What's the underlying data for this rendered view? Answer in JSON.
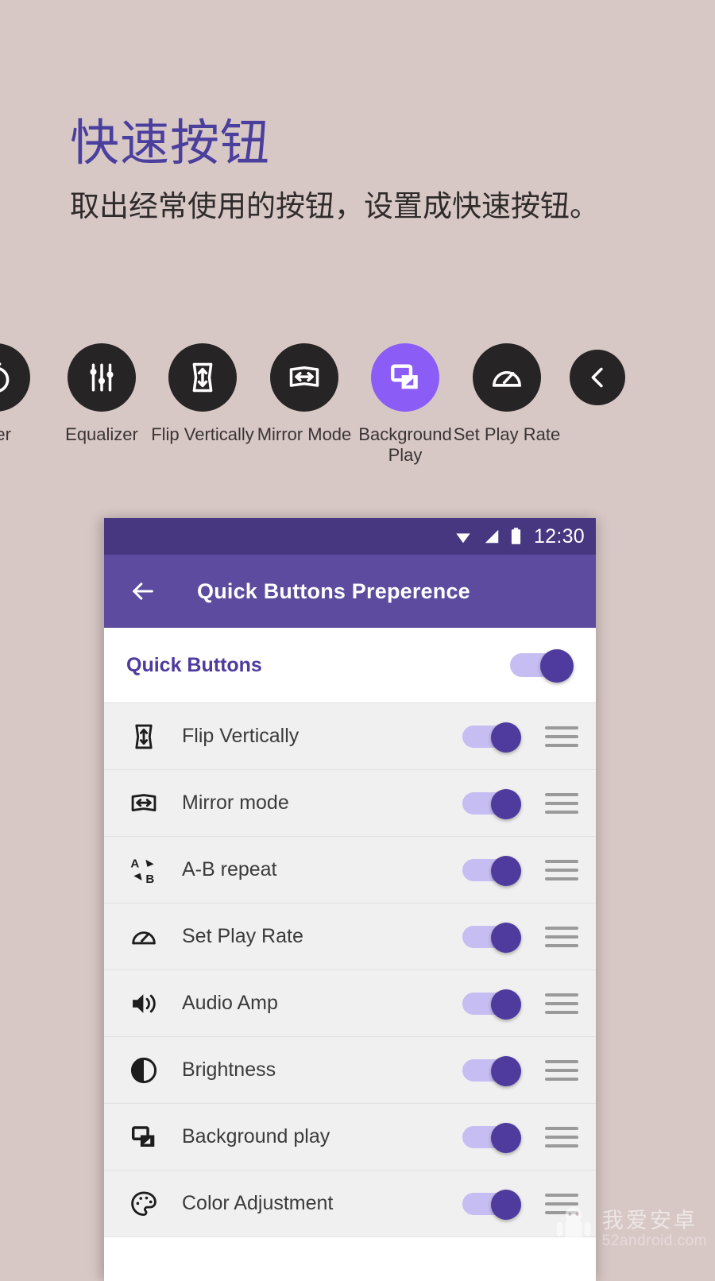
{
  "promo": {
    "title": "快速按钮",
    "subtitle": "取出经常使用的按钮，设置成快速按钮。",
    "title_color": "#4b3f9e",
    "background_color": "#d7c8c6"
  },
  "carousel": {
    "items": [
      {
        "label": "mer",
        "icon": "timer-icon",
        "active": false,
        "partial": true
      },
      {
        "label": "Equalizer",
        "icon": "equalizer-icon",
        "active": false
      },
      {
        "label": "Flip Vertically",
        "icon": "flip-vertically-icon",
        "active": false
      },
      {
        "label": "Mirror Mode",
        "icon": "mirror-mode-icon",
        "active": false
      },
      {
        "label": "Background Play",
        "icon": "background-play-icon",
        "active": true
      },
      {
        "label": "Set Play Rate",
        "icon": "set-play-rate-icon",
        "active": false
      },
      {
        "label": "",
        "icon": "chevron-left-icon",
        "active": false
      }
    ],
    "active_color": "#8b5cf6",
    "circle_color": "#272425"
  },
  "phone": {
    "statusbar": {
      "time": "12:30",
      "icons": [
        "wifi-icon",
        "signal-icon",
        "battery-icon"
      ],
      "background": "#473680"
    },
    "appbar": {
      "title": "Quick Buttons Preperence",
      "back_icon": "back-arrow-icon",
      "background": "#5c4b9e"
    },
    "master": {
      "label": "Quick Buttons",
      "enabled": true
    },
    "rows": [
      {
        "label": "Flip Vertically",
        "icon": "flip-vertically-icon",
        "enabled": true,
        "handle": "drag-handle-icon"
      },
      {
        "label": "Mirror mode",
        "icon": "mirror-mode-icon",
        "enabled": true,
        "handle": "drag-handle-icon"
      },
      {
        "label": "A-B repeat",
        "icon": "ab-repeat-icon",
        "enabled": true,
        "handle": "drag-handle-icon"
      },
      {
        "label": "Set Play Rate",
        "icon": "set-play-rate-icon",
        "enabled": true,
        "handle": "drag-handle-icon"
      },
      {
        "label": "Audio Amp",
        "icon": "audio-amp-icon",
        "enabled": true,
        "handle": "drag-handle-icon"
      },
      {
        "label": "Brightness",
        "icon": "brightness-icon",
        "enabled": true,
        "handle": "drag-handle-icon"
      },
      {
        "label": "Background play",
        "icon": "background-play-icon",
        "enabled": true,
        "handle": "drag-handle-icon"
      },
      {
        "label": "Color Adjustment",
        "icon": "color-adjustment-icon",
        "enabled": true,
        "handle": "drag-handle-icon"
      }
    ],
    "toggle_colors": {
      "track": "#c6bdf2",
      "thumb": "#4f3a9e"
    }
  },
  "watermark": {
    "cn": "我爱安卓",
    "en": "52android.com",
    "logo": "android-robot-icon"
  }
}
